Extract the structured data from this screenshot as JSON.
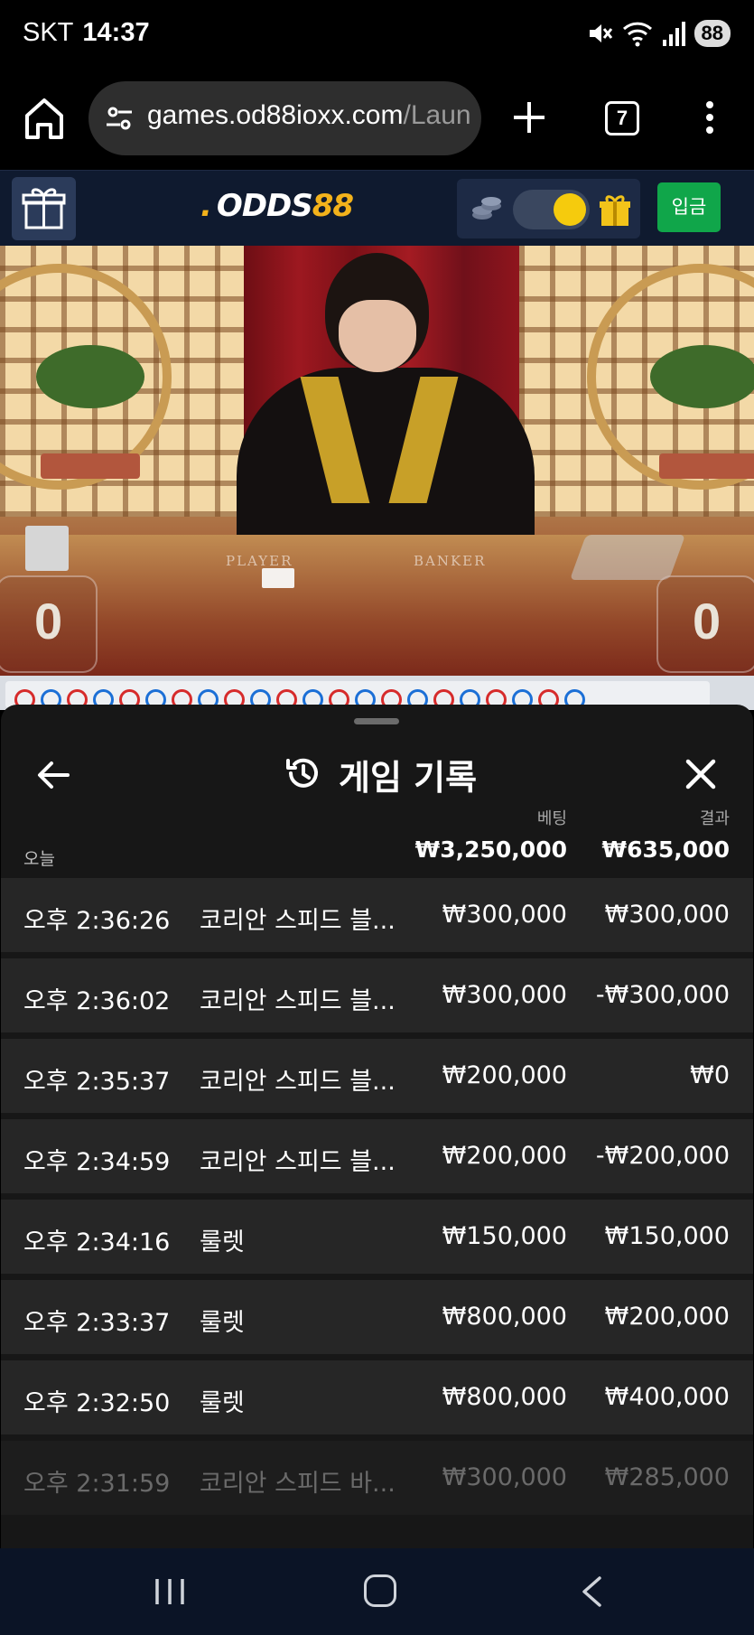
{
  "status_bar": {
    "carrier": "SKT",
    "time": "14:37",
    "battery": "88"
  },
  "browser": {
    "url_host": "games.od88ioxx.com",
    "url_path": "/Laun",
    "tab_count": "7"
  },
  "site_header": {
    "logo_main": "ODDS",
    "logo_num": "88",
    "deposit_label": "입금",
    "accent_color": "#f3b21b",
    "deposit_color": "#10a64a"
  },
  "video": {
    "player_label": "PLAYER",
    "banker_label": "BANKER",
    "player_score": "0",
    "banker_score": "0"
  },
  "history_panel": {
    "title": "게임 기록",
    "col_bet": "베팅",
    "col_result": "결과",
    "summary": {
      "day_label": "오늘",
      "total_bet": "₩3,250,000",
      "total_result": "₩635,000"
    },
    "rows": [
      {
        "time": "오후 2:36:26",
        "game": "코리안 스피드 블...",
        "bet": "₩300,000",
        "result": "₩300,000"
      },
      {
        "time": "오후 2:36:02",
        "game": "코리안 스피드 블...",
        "bet": "₩300,000",
        "result": "-₩300,000"
      },
      {
        "time": "오후 2:35:37",
        "game": "코리안 스피드 블...",
        "bet": "₩200,000",
        "result": "₩0"
      },
      {
        "time": "오후 2:34:59",
        "game": "코리안 스피드 블...",
        "bet": "₩200,000",
        "result": "-₩200,000"
      },
      {
        "time": "오후 2:34:16",
        "game": "룰렛",
        "bet": "₩150,000",
        "result": "₩150,000"
      },
      {
        "time": "오후 2:33:37",
        "game": "룰렛",
        "bet": "₩800,000",
        "result": "₩200,000"
      },
      {
        "time": "오후 2:32:50",
        "game": "룰렛",
        "bet": "₩800,000",
        "result": "₩400,000"
      },
      {
        "time": "오후 2:31:59",
        "game": "코리안 스피드 바...",
        "bet": "₩300,000",
        "result": "₩285,000"
      }
    ]
  }
}
